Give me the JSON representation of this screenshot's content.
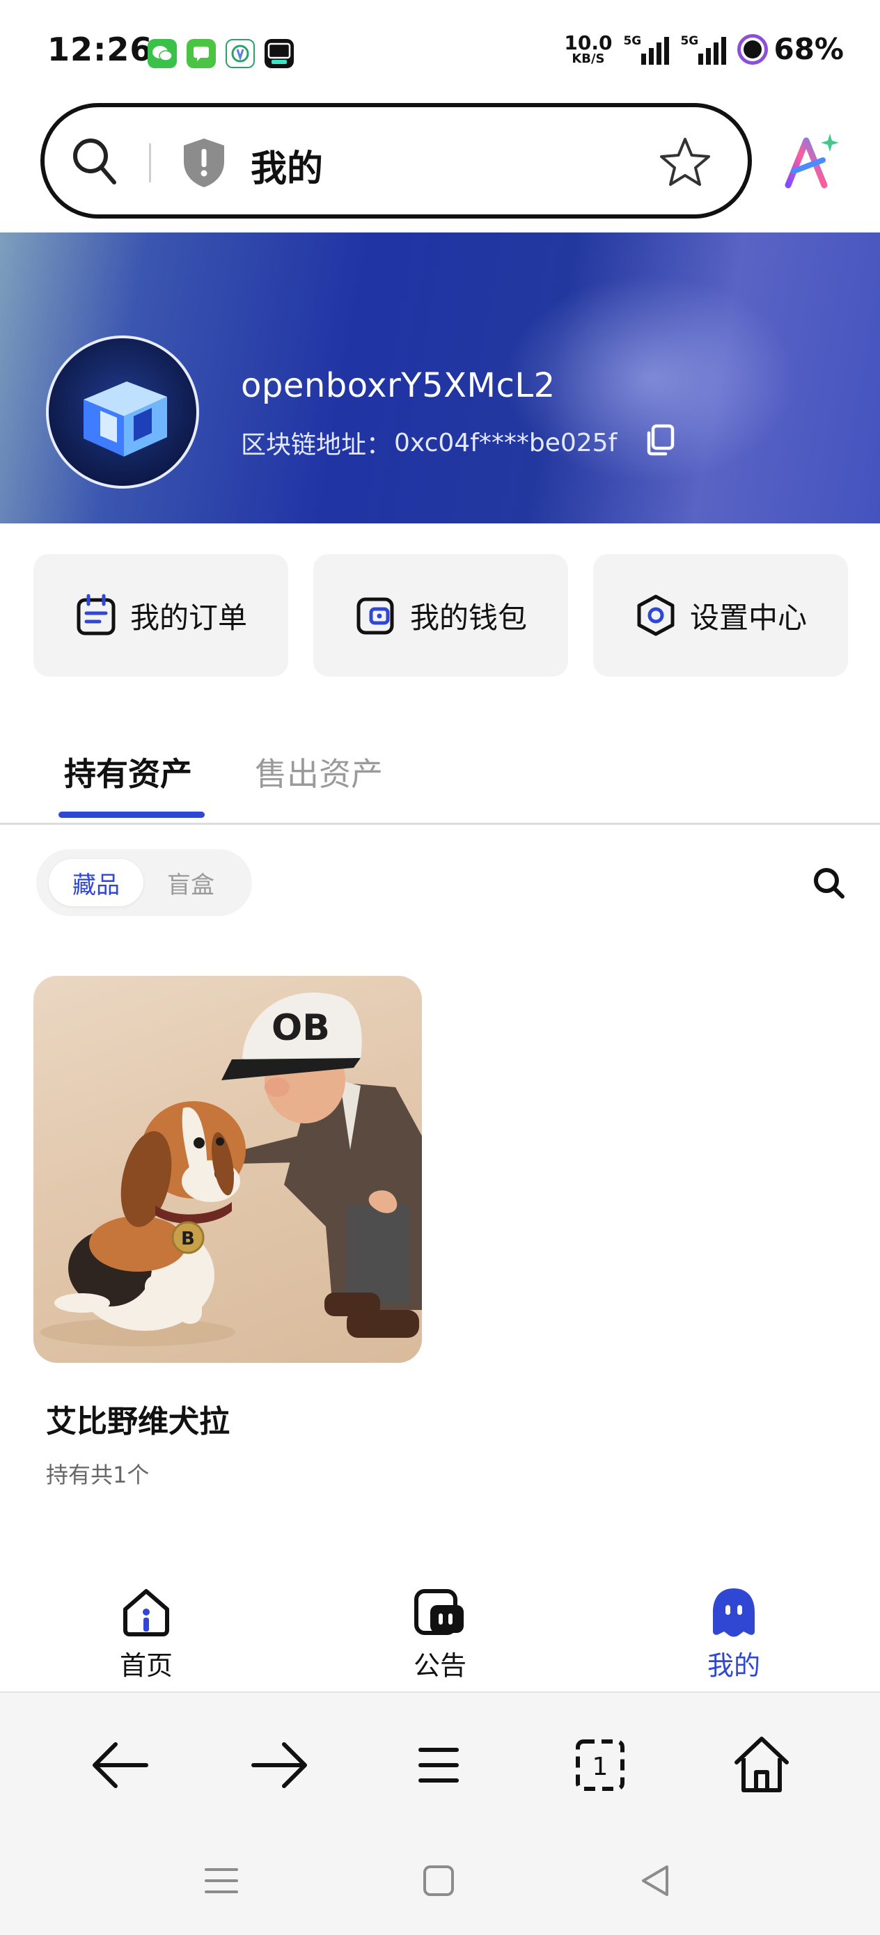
{
  "status_bar": {
    "time": "12:26",
    "net_speed_value": "10.0",
    "net_speed_unit": "KB/S",
    "signal1_label": "5G",
    "signal2_label": "5G",
    "battery": "68%",
    "app_icons": [
      "wechat-icon",
      "messages-icon",
      "green-app-icon",
      "dewu-icon"
    ]
  },
  "address_bar": {
    "title": "我的"
  },
  "profile": {
    "username": "openboxrY5XMcL2",
    "chain_label": "区块链地址：",
    "chain_address": "0xc04f****be025f"
  },
  "quick_actions": [
    {
      "label": "我的订单",
      "icon": "order-icon"
    },
    {
      "label": "我的钱包",
      "icon": "wallet-icon"
    },
    {
      "label": "设置中心",
      "icon": "settings-icon"
    }
  ],
  "tabs": [
    {
      "label": "持有资产",
      "active": true
    },
    {
      "label": "售出资产",
      "active": false
    }
  ],
  "segmented": {
    "options": [
      "藏品",
      "盲盒"
    ],
    "selected": "藏品"
  },
  "collectibles": [
    {
      "name": "艾比野维犬拉",
      "holding": "持有共1个",
      "image_badge_1": "OB",
      "image_badge_2": "B"
    }
  ],
  "app_nav": [
    {
      "label": "首页",
      "icon": "home-icon",
      "active": false
    },
    {
      "label": "公告",
      "icon": "notice-icon",
      "active": false
    },
    {
      "label": "我的",
      "icon": "profile-icon",
      "active": true
    }
  ],
  "browser_toolbar": {
    "tab_count": "1",
    "buttons": [
      "back-arrow-icon",
      "forward-arrow-icon",
      "menu-icon",
      "tabs-icon",
      "home-icon"
    ]
  },
  "colors": {
    "accent": "#3047d4",
    "card_bg": "#f3f3f4",
    "banner_dark": "#2034a4"
  }
}
